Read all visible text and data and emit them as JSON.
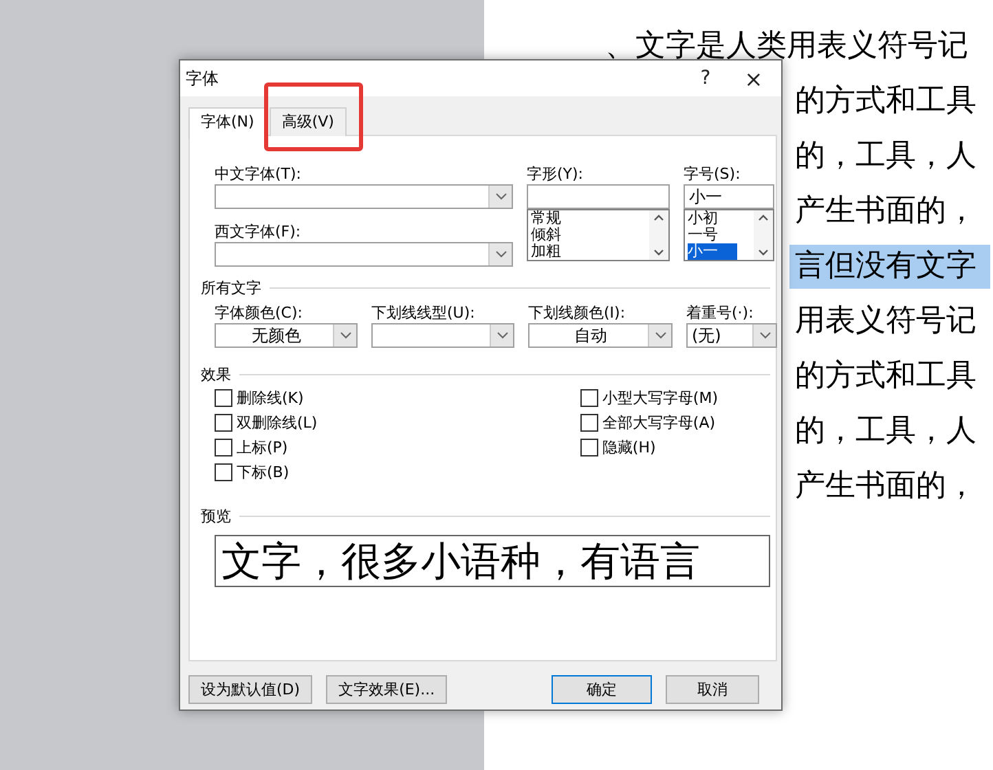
{
  "document": {
    "lines": [
      {
        "text": "、文字是人类用表义符号记",
        "highlighted": false,
        "kind": "lead"
      },
      {
        "text": "的方式和工具",
        "highlighted": false,
        "kind": "body"
      },
      {
        "text": "的，工具，人",
        "highlighted": false,
        "kind": "body"
      },
      {
        "text": "产生书面的，",
        "highlighted": false,
        "kind": "body"
      },
      {
        "text": "言但没有文字",
        "highlighted": true,
        "kind": "body"
      },
      {
        "text": "用表义符号记",
        "highlighted": false,
        "kind": "body"
      },
      {
        "text": "的方式和工具",
        "highlighted": false,
        "kind": "body"
      },
      {
        "text": "的，工具，人",
        "highlighted": false,
        "kind": "body"
      },
      {
        "text": "产生书面的，",
        "highlighted": false,
        "kind": "body"
      }
    ]
  },
  "dialog": {
    "title": "字体",
    "help": "?",
    "close": "×",
    "tabs": [
      {
        "label": "字体(N)",
        "selected": true,
        "annotated": false
      },
      {
        "label": "高级(V)",
        "selected": false,
        "annotated": true
      }
    ],
    "chinese_font": {
      "label": "中文字体(T):"
    },
    "western_font": {
      "label": "西文字体(F):"
    },
    "style": {
      "label": "字形(Y):",
      "options": [
        {
          "label": "常规",
          "selected": false
        },
        {
          "label": "倾斜",
          "selected": false
        },
        {
          "label": "加粗",
          "selected": false
        }
      ]
    },
    "size": {
      "label": "字号(S):",
      "value": "小一",
      "options": [
        {
          "label": "小初",
          "selected": false
        },
        {
          "label": "一号",
          "selected": false
        },
        {
          "label": "小一",
          "selected": true
        }
      ]
    },
    "all_text": {
      "heading": "所有文字",
      "dropdowns": [
        {
          "label": "字体颜色(C):",
          "value": "无颜色",
          "kind": "centered"
        },
        {
          "label": "下划线线型(U):",
          "kind": "centered"
        },
        {
          "label": "下划线颜色(I):",
          "value": "自动",
          "kind": "centered"
        },
        {
          "label": "着重号(·):",
          "value": "(无)",
          "kind": "left"
        }
      ]
    },
    "effects": {
      "heading": "效果",
      "left": [
        {
          "label": "删除线(K)",
          "checked": false
        },
        {
          "label": "双删除线(L)",
          "checked": false
        },
        {
          "label": "上标(P)",
          "checked": false
        },
        {
          "label": "下标(B)",
          "checked": false
        }
      ],
      "right": [
        {
          "label": "小型大写字母(M)",
          "checked": false
        },
        {
          "label": "全部大写字母(A)",
          "checked": false
        },
        {
          "label": "隐藏(H)",
          "checked": false
        }
      ]
    },
    "preview": {
      "heading": "预览",
      "text": "文字，很多小语种，有语言"
    },
    "buttons": [
      {
        "label": "设为默认值(D)",
        "kind": "left"
      },
      {
        "label": "文字效果(E)...",
        "kind": "left"
      },
      {
        "label": "确定",
        "kind": "default"
      },
      {
        "label": "取消",
        "kind": "normal"
      }
    ]
  }
}
